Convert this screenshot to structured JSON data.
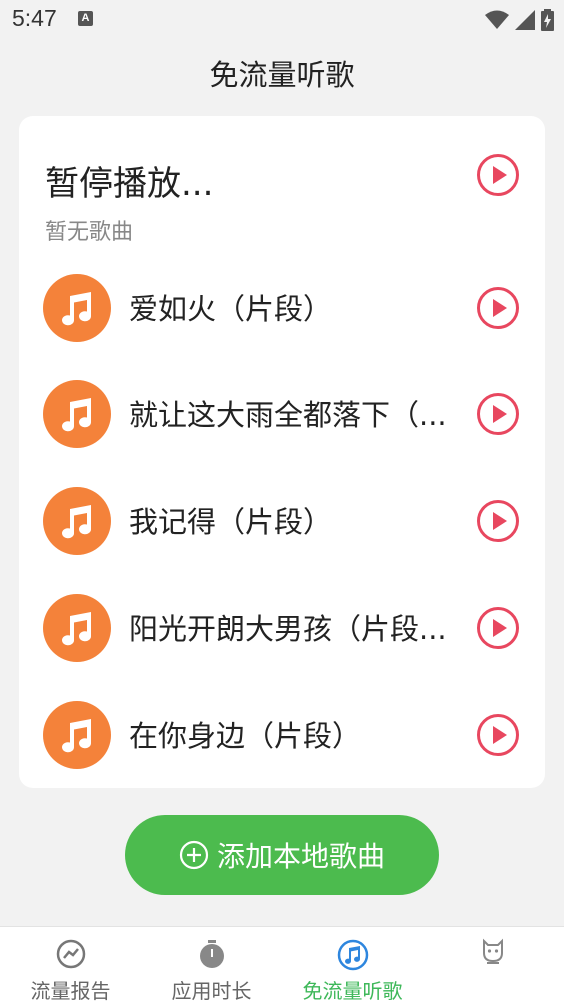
{
  "status_bar": {
    "time": "5:47",
    "notification_badge": "A"
  },
  "header": {
    "title": "免流量听歌"
  },
  "now_playing": {
    "title": "暂停播放...",
    "subtitle": "暂无歌曲"
  },
  "songs": [
    {
      "name": "爱如火（片段）"
    },
    {
      "name": "就让这大雨全都落下（..."
    },
    {
      "name": "我记得（片段）"
    },
    {
      "name": "阳光开朗大男孩（片段..."
    },
    {
      "name": "在你身边（片段）"
    }
  ],
  "add_button": {
    "label": "添加本地歌曲"
  },
  "bottom_nav": [
    {
      "label": "流量报告",
      "icon": "chart-icon"
    },
    {
      "label": "应用时长",
      "icon": "timer-icon"
    },
    {
      "label": "免流量听歌",
      "icon": "music-note-icon",
      "active": true
    },
    {
      "label": "",
      "icon": "mascot-icon"
    }
  ],
  "colors": {
    "accent_green": "#4cbb4e",
    "nav_active": "#3fb85a",
    "song_avatar": "#f4823a",
    "play_red": "#e8475f"
  }
}
